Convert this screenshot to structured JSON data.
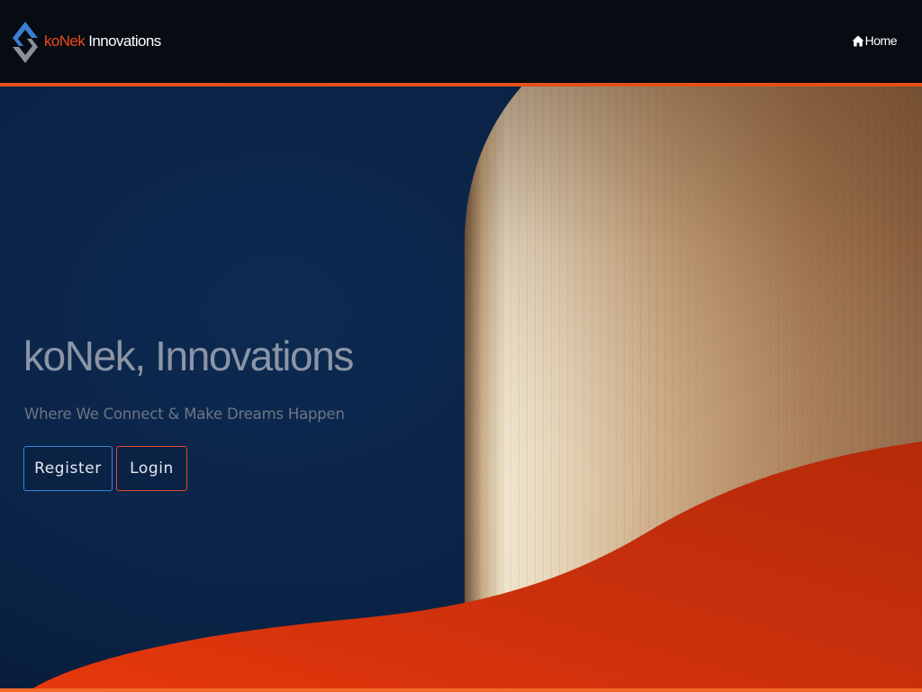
{
  "navbar": {
    "brand_accent": "koNek",
    "brand_rest": " Innovations",
    "home_label": "Home",
    "home_icon": "home-icon",
    "logo_icon": "diamond-logo-icon"
  },
  "hero": {
    "title": "koNek, Innovations",
    "subtitle": "Where We Connect & Make Dreams Happen",
    "register_label": "Register",
    "login_label": "Login"
  },
  "colors": {
    "accent_orange": "#e8501a",
    "navy_background": "#0a2244",
    "register_border": "#3a86d6",
    "login_border": "#e04a2a",
    "logo_blue": "#3a7fd0",
    "logo_gray": "#8a8f99"
  }
}
